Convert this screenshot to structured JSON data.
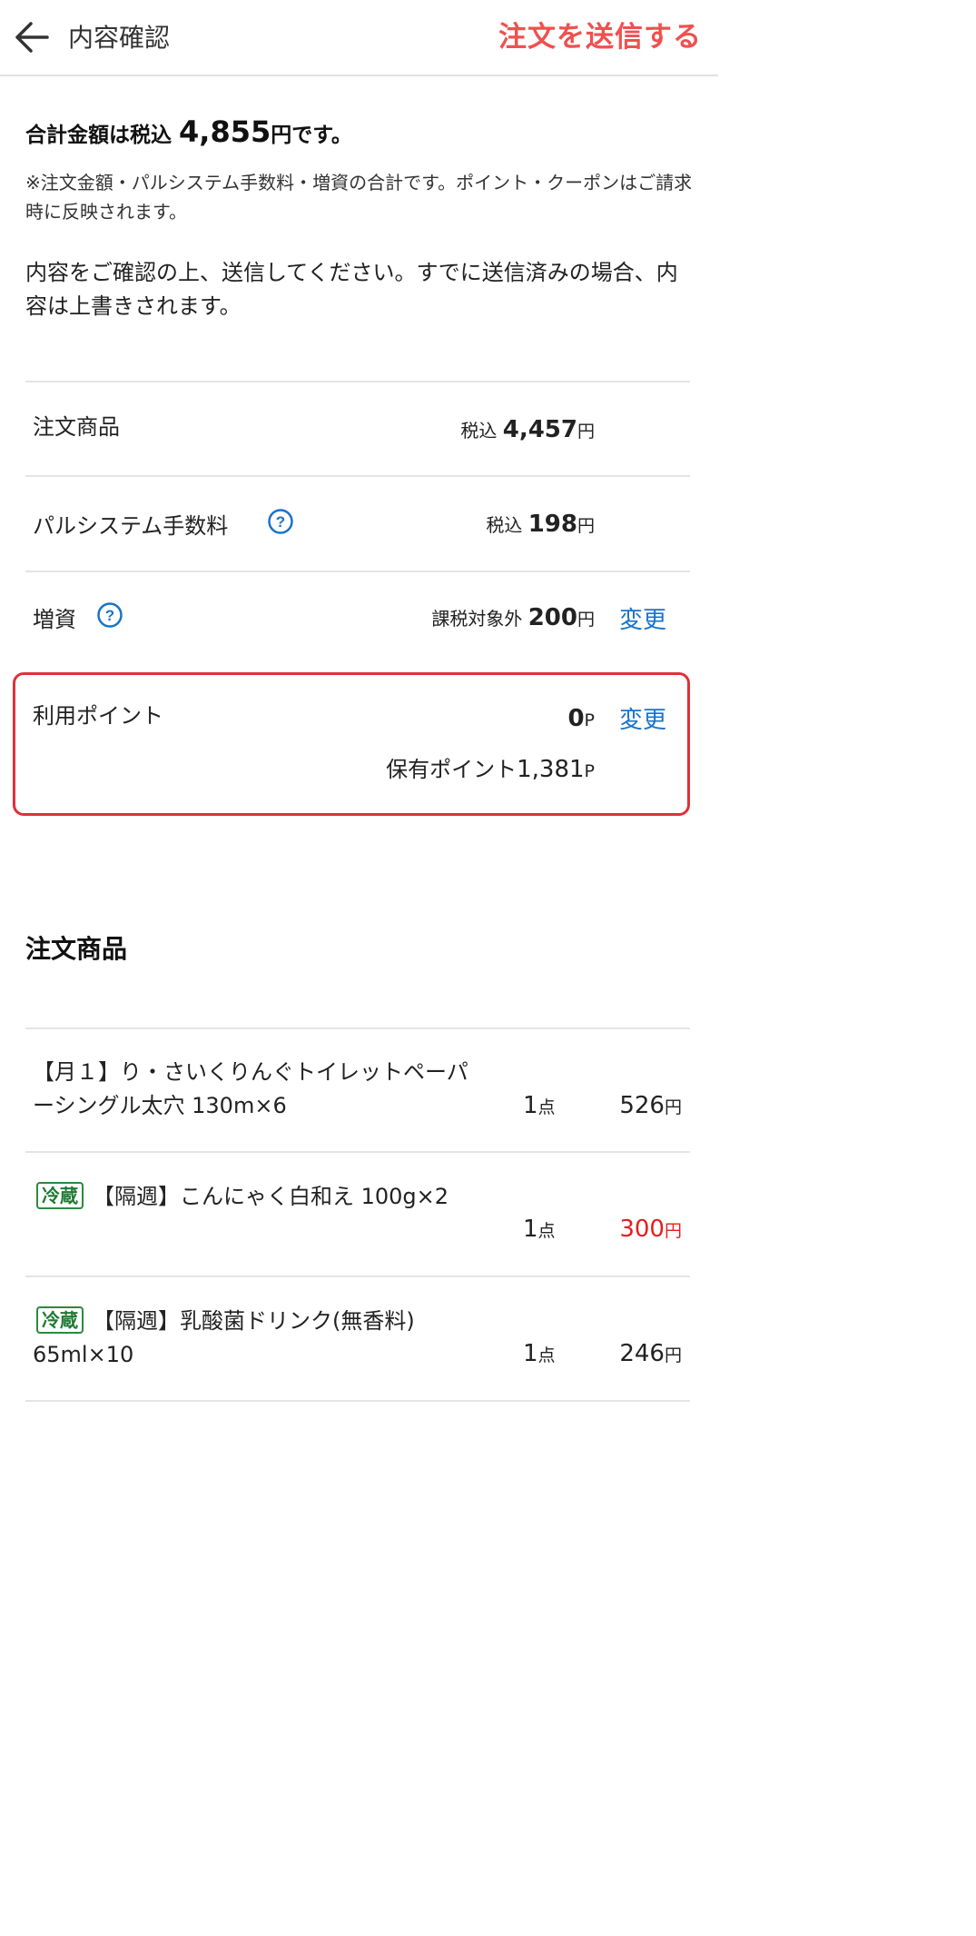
{
  "header": {
    "title": "内容確認",
    "submit_label": "注文を送信する"
  },
  "summary": {
    "total_prefix": "合計金額は税込",
    "total_amount": "4,855",
    "total_suffix": "円です。",
    "note": "※注文金額・パルシステム手数料・増資の合計です。ポイント・クーポンはご請求時に反映されます。",
    "confirm_text": "内容をご確認の上、送信してください。すでに送信済みの場合、内容は上書きされます。"
  },
  "breakdown": {
    "order_items": {
      "label": "注文商品",
      "tax_label": "税込",
      "amount": "4,457",
      "unit": "円"
    },
    "fee": {
      "label": "パルシステム手数料",
      "tax_label": "税込",
      "amount": "198",
      "unit": "円"
    },
    "capital": {
      "label": "増資",
      "tax_label": "課税対象外",
      "amount": "200",
      "unit": "円",
      "change_label": "変更"
    },
    "points": {
      "label": "利用ポイント",
      "amount": "0",
      "unit": "P",
      "change_label": "変更",
      "held_label": "保有ポイント",
      "held_amount": "1,381",
      "held_unit": "P"
    }
  },
  "items_section": {
    "title": "注文商品",
    "items": [
      {
        "tag": "",
        "name": "【月１】り・さいくりんぐトイレットペーパーシングル太穴 130m×6",
        "qty": "1",
        "qty_unit": "点",
        "price": "526",
        "price_unit": "円",
        "price_color": "#222222"
      },
      {
        "tag": "冷蔵",
        "name": "【隔週】こんにゃく白和え 100g×2",
        "qty": "1",
        "qty_unit": "点",
        "price": "300",
        "price_unit": "円",
        "price_color": "#e02020"
      },
      {
        "tag": "冷蔵",
        "name": "【隔週】乳酸菌ドリンク(無香料) 65ml×10",
        "qty": "1",
        "qty_unit": "点",
        "price": "246",
        "price_unit": "円",
        "price_color": "#222222"
      }
    ]
  },
  "colors": {
    "accent": "#f0504f",
    "link": "#1a73c8",
    "highlight_border": "#e0303a",
    "cold_tag": "#1f7a33"
  },
  "icons": {
    "back": "arrow-left-icon",
    "help": "question-circle-icon"
  }
}
